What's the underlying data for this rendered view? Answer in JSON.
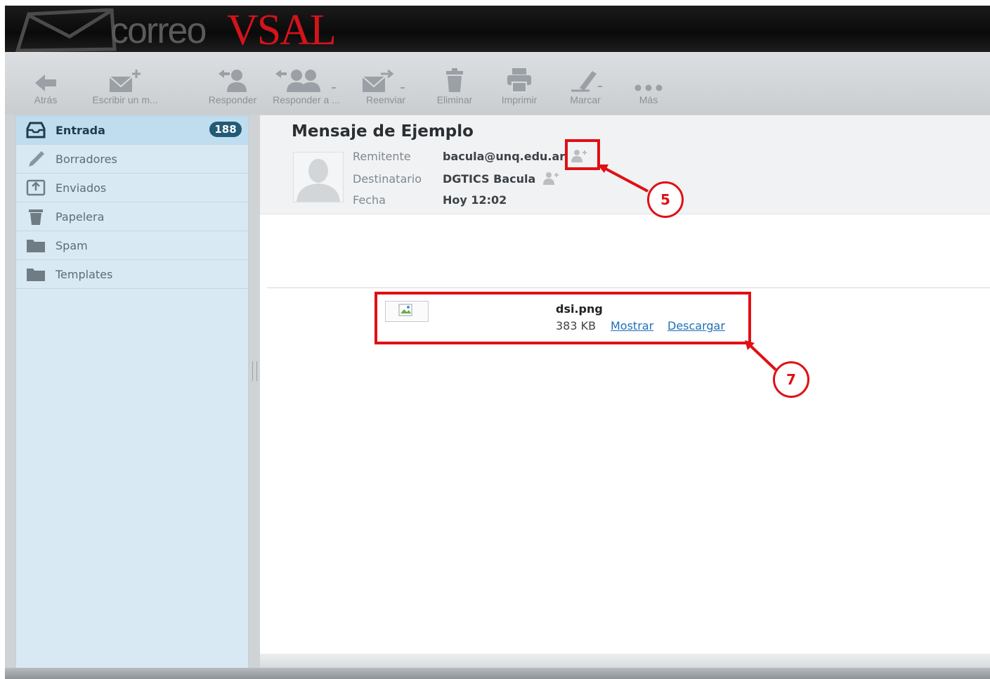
{
  "app": {
    "logo_part1": "correo",
    "logo_part2": "VSAL"
  },
  "toolbar": {
    "buttons": [
      {
        "label": "Atrás",
        "icon": "back-arrow-icon"
      },
      {
        "label": "Escribir un m...",
        "icon": "compose-icon"
      },
      {
        "label": "Responder",
        "icon": "reply-icon"
      },
      {
        "label": "Responder a ...",
        "icon": "reply-all-icon"
      },
      {
        "label": "Reenviar",
        "icon": "forward-icon"
      },
      {
        "label": "Eliminar",
        "icon": "trash-icon"
      },
      {
        "label": "Imprimir",
        "icon": "print-icon"
      },
      {
        "label": "Marcar",
        "icon": "mark-icon"
      },
      {
        "label": "Más",
        "icon": "more-icon"
      }
    ]
  },
  "sidebar": {
    "folders": [
      {
        "label": "Entrada",
        "icon": "inbox-icon",
        "count": "188",
        "selected": true
      },
      {
        "label": "Borradores",
        "icon": "pencil-icon"
      },
      {
        "label": "Enviados",
        "icon": "sent-icon"
      },
      {
        "label": "Papelera",
        "icon": "trash-icon"
      },
      {
        "label": "Spam",
        "icon": "folder-icon"
      },
      {
        "label": "Templates",
        "icon": "folder-icon"
      }
    ]
  },
  "message": {
    "subject": "Mensaje de Ejemplo",
    "from_label": "Remitente",
    "from_value": "bacula@unq.edu.ar",
    "to_label": "Destinatario",
    "to_value": "DGTICS Bacula",
    "date_label": "Fecha",
    "date_value": "Hoy 12:02"
  },
  "attachment": {
    "name": "dsi.png",
    "size": "383 KB",
    "show_label": "Mostrar",
    "download_label": "Descargar"
  },
  "annotations": {
    "callout_a": "5",
    "callout_b": "7",
    "color": "#e10f14"
  },
  "colors": {
    "accent": "#235a75",
    "logo_red": "#d4131a",
    "link": "#1f6fb8"
  }
}
